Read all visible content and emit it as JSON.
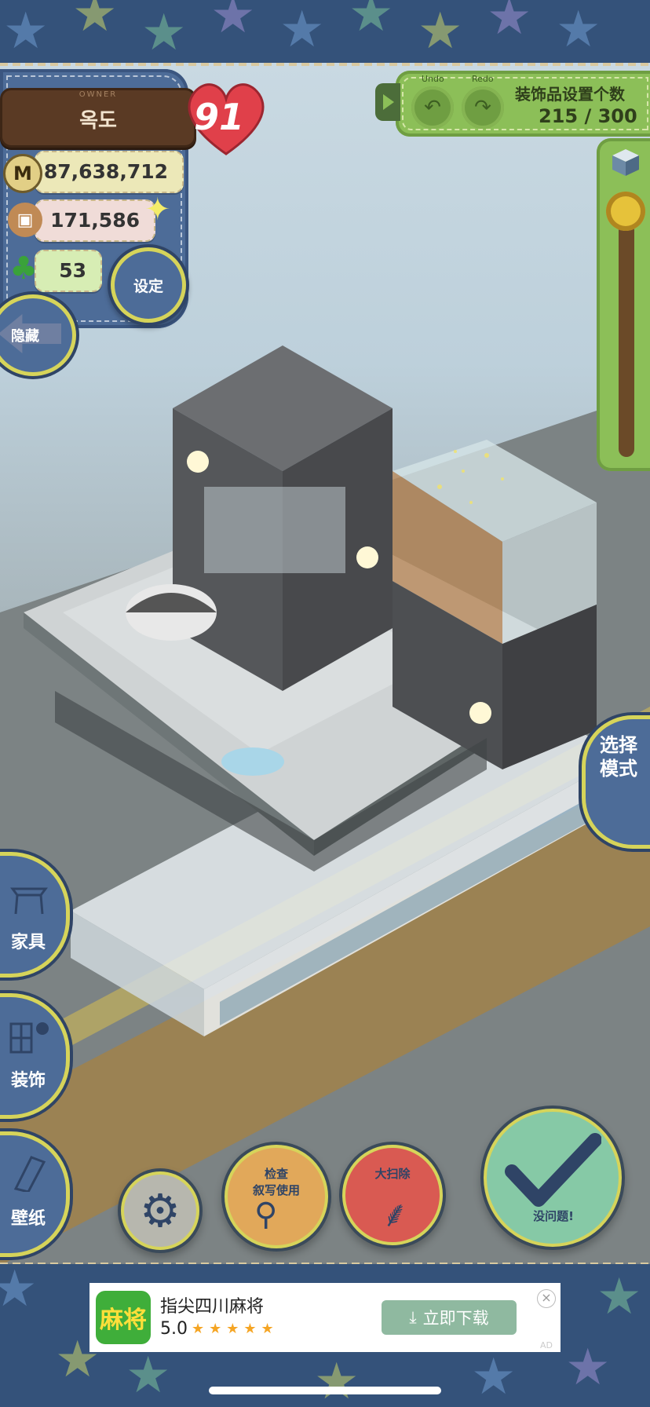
{
  "owner": {
    "label": "OWNER",
    "name": "옥도"
  },
  "heart_count": "91",
  "stats": {
    "money": "87,638,712",
    "money_icon": "M",
    "items": "171,586",
    "clover": "53"
  },
  "buttons": {
    "settings": "设定",
    "hide": "隐藏",
    "select_mode": "选择模式",
    "furniture": "家具",
    "decoration": "装饰",
    "wallpaper": "壁纸",
    "search": "检查\n叙写使用",
    "cleanup": "大扫除",
    "confirm": "没问题!"
  },
  "deco": {
    "undo": "Undo",
    "redo": "Redo",
    "title": "装饰品设置个数",
    "count": "215 / 300"
  },
  "ad": {
    "icon_text": "麻将",
    "title": "指尖四川麻将",
    "rating": "5.0",
    "stars": "★★★★★",
    "download": "立即下载",
    "close": "×",
    "tag": "AD"
  },
  "colors": {
    "denim": "#4d6c98",
    "green_panel": "#8cbf58",
    "heart": "#e0404a",
    "accent_yellow": "#d6d45a"
  }
}
